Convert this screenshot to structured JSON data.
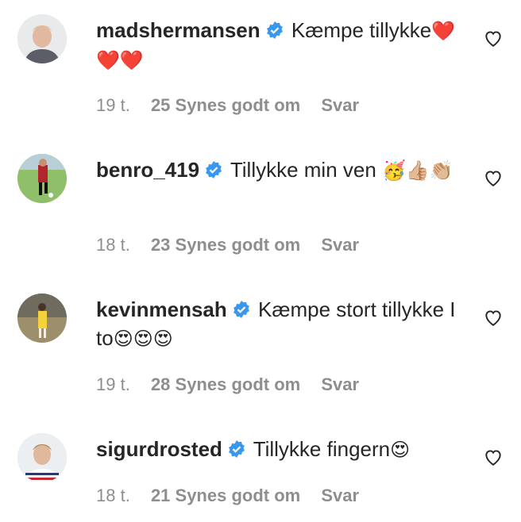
{
  "comments": [
    {
      "username": "madshermansen",
      "text": "Kæmpe tillykke",
      "emoji": "❤️❤️❤️",
      "time": "19 t.",
      "likes": "25 Synes godt om",
      "reply": "Svar"
    },
    {
      "username": "benro_419",
      "text": "Tillykke min ven",
      "emoji": "🥳👍🏼👏🏼",
      "time": "18 t.",
      "likes": "23 Synes godt om",
      "reply": "Svar"
    },
    {
      "username": "kevinmensah",
      "text": "Kæmpe stort tillykke I to",
      "emoji": "😍😍😍",
      "time": "19 t.",
      "likes": "28 Synes godt om",
      "reply": "Svar"
    },
    {
      "username": "sigurdrosted",
      "text": "Tillykke fingern",
      "emoji": "😍",
      "time": "18 t.",
      "likes": "21 Synes godt om",
      "reply": "Svar"
    }
  ],
  "icons": {
    "verified": "verified-badge-icon",
    "like": "heart-outline-icon"
  },
  "colors": {
    "verified": "#3897f0",
    "meta": "#8e8e8e",
    "text": "#262626"
  }
}
